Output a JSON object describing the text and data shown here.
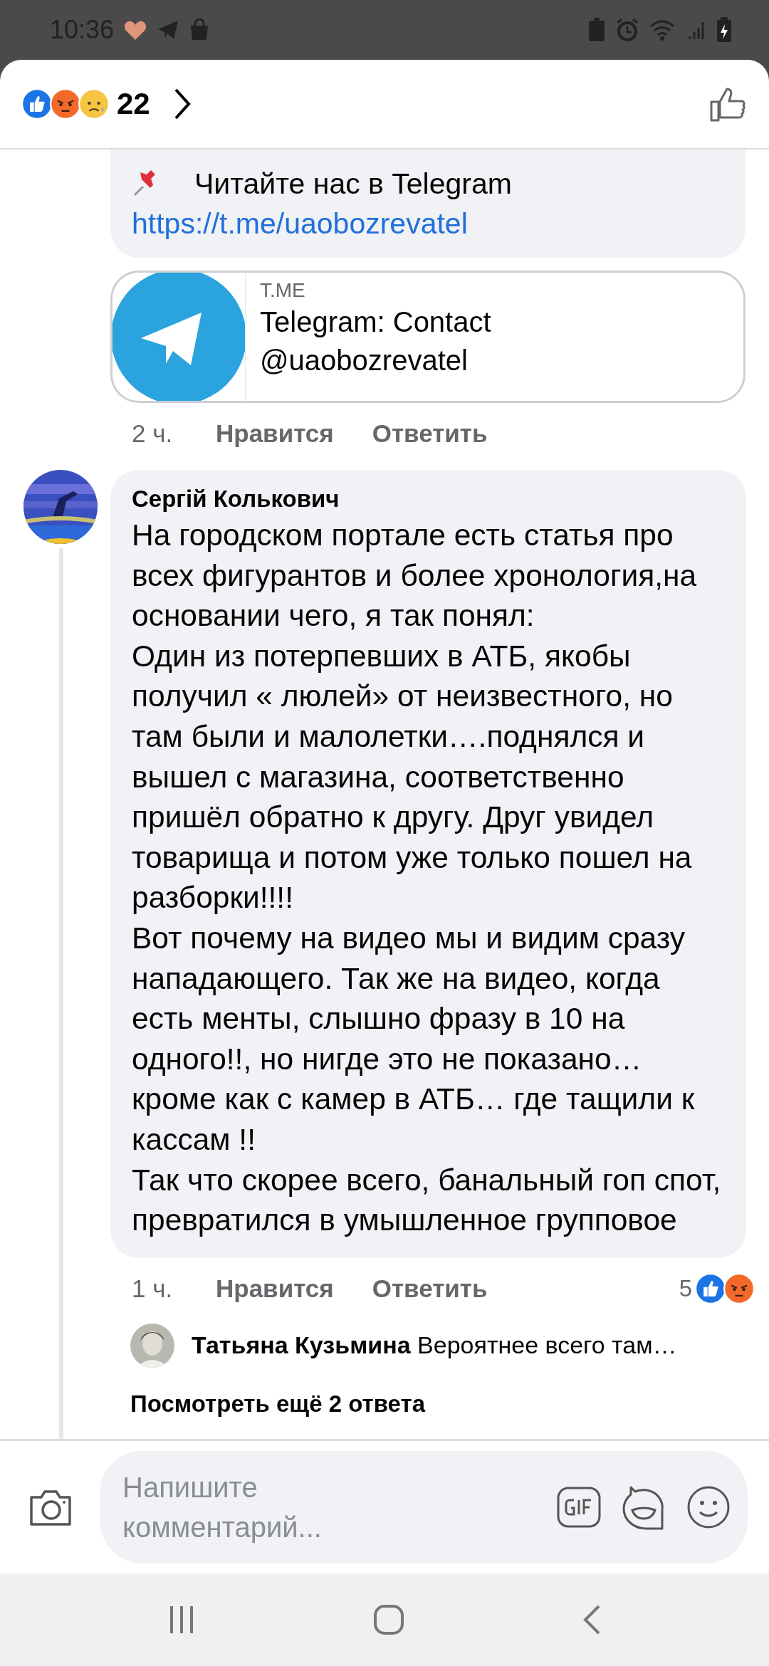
{
  "status_bar": {
    "time": "10:36"
  },
  "header": {
    "reaction_count": "22"
  },
  "post_fragment": {
    "text": "Читайте нас в Telegram",
    "link": "https://t.me/uaobozrevatel",
    "preview": {
      "domain": "T.ME",
      "title": "Telegram: Contact @uaobozrevatel"
    },
    "time": "2 ч.",
    "like": "Нравится",
    "reply": "Ответить"
  },
  "comment": {
    "author": "Сергій Колькович",
    "text": "На городском портале есть статья про всех фигурантов и более хронология,на основании чего, я так понял:\nОдин из потерпевших  в АТБ, якобы получил « люлей» от неизвестного, но там были и малолетки….поднялся и вышел с магазина, соответственно пришёл обратно к другу. Друг увидел товарища и потом уже только пошел на разборки!!!!\nВот почему на видео мы и видим сразу нападающего. Так же на видео, когда есть менты, слышно фразу в 10 на одного!!, но нигде это не показано…кроме как с камер в АТБ… где тащили к кассам !!\nТак что скорее всего, банальный гоп спот, превратился в умышленное групповое",
    "time": "1 ч.",
    "like": "Нравится",
    "reply": "Ответить",
    "reaction_count": "5"
  },
  "reply": {
    "author": "Татьяна Кузьмина",
    "text": "Вероятнее всего там…"
  },
  "more_replies": "Посмотреть ещё 2 ответа",
  "composer": {
    "placeholder": "Напишите комментарий..."
  }
}
